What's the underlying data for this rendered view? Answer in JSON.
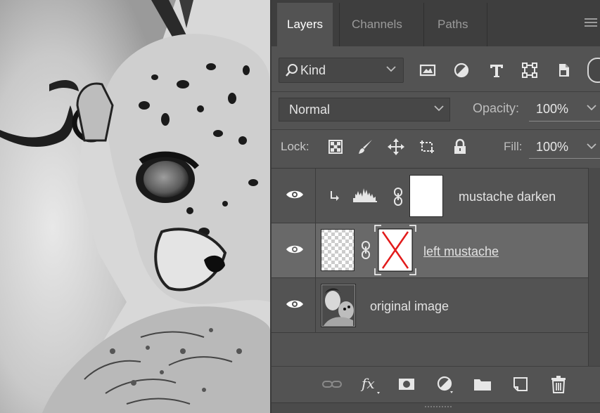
{
  "panel": {
    "tabs": [
      {
        "label": "Layers",
        "active": true
      },
      {
        "label": "Channels",
        "active": false
      },
      {
        "label": "Paths",
        "active": false
      }
    ]
  },
  "filter": {
    "kind_label": "Kind",
    "icons": [
      "image-filter-icon",
      "adjustment-filter-icon",
      "type-filter-icon",
      "shape-filter-icon",
      "smart-object-filter-icon"
    ]
  },
  "blend": {
    "mode": "Normal",
    "opacity_label": "Opacity:",
    "opacity_value": "100%"
  },
  "lock": {
    "label": "Lock:",
    "fill_label": "Fill:",
    "fill_value": "100%"
  },
  "layers": [
    {
      "name": "mustache darken",
      "type": "levels-adjustment",
      "clipped": true,
      "visible": true,
      "selected": false
    },
    {
      "name": "left mustache",
      "type": "pixel-with-mask",
      "visible": true,
      "selected": true
    },
    {
      "name": "original image",
      "type": "pixel",
      "visible": true,
      "selected": false
    }
  ],
  "footer": {
    "icons": [
      "link-layers-icon",
      "fx-icon",
      "add-mask-icon",
      "adjustment-layer-icon",
      "new-group-icon",
      "new-layer-icon",
      "trash-icon"
    ]
  },
  "colors": {
    "panel_bg": "#535353",
    "tab_bar_bg": "#3e3e3e",
    "selected_layer_bg": "#696969",
    "mask_x_stroke": "#e21b1b"
  }
}
